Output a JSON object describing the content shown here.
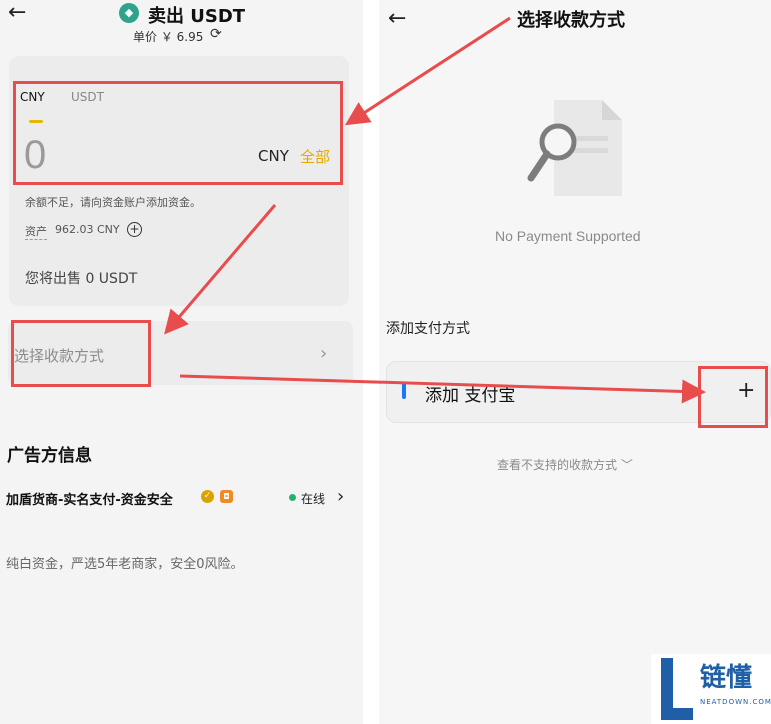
{
  "left": {
    "back_icon": "arrow-left-icon",
    "title": "卖出 USDT",
    "price": "单价 ￥ 6.95",
    "refresh_icon": "refresh-icon",
    "tabs": [
      "CNY",
      "USDT"
    ],
    "amount_value": "0",
    "currency": "CNY",
    "all_button": "全部",
    "insufficient": "余额不足，请向资金账户添加资金。",
    "assets_label": "资产",
    "assets_value": "962.03 CNY",
    "sell_text": "您将出售 0 USDT",
    "payment_method": "选择收款方式",
    "advertiser_title": "广告方信息",
    "merchant": "加盾货商-实名支付-资金安全",
    "online": "在线",
    "description": "纯白资金，严选5年老商家，安全0风险。"
  },
  "right": {
    "back_icon": "arrow-left-icon",
    "title": "选择收款方式",
    "empty_text": "No Payment Supported",
    "add_title": "添加支付方式",
    "alipay_label": "添加 支付宝",
    "add_icon": "plus-icon",
    "unsupported": "查看不支持的收款方式"
  },
  "watermark": {
    "text": "链懂",
    "sub": "NEATDOWN.COM"
  },
  "colors": {
    "accent": "#e6a800",
    "annotation": "#e84c4c",
    "online": "#25b36b",
    "alipay": "#1677ff"
  }
}
